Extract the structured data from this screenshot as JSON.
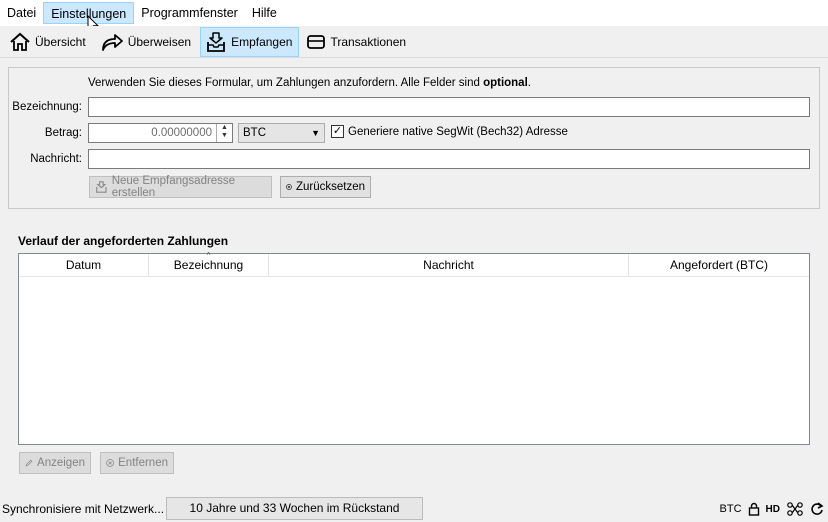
{
  "menubar": {
    "items": [
      {
        "label": "Datei"
      },
      {
        "label": "Einstellungen"
      },
      {
        "label": "Programmfenster"
      },
      {
        "label": "Hilfe"
      }
    ]
  },
  "toolbar": {
    "overview": "Übersicht",
    "send": "Überweisen",
    "receive": "Empfangen",
    "transactions": "Transaktionen"
  },
  "form": {
    "hint_prefix": "Verwenden Sie dieses Formular, um Zahlungen anzufordern. Alle Felder sind ",
    "hint_bold": "optional",
    "hint_suffix": ".",
    "label_label": "Bezeichnung:",
    "label_value": "",
    "amount_label": "Betrag:",
    "amount_value": "0.00000000",
    "unit_value": "BTC",
    "segwit_label": "Generiere native SegWit (Bech32) Adresse",
    "segwit_checked": true,
    "message_label": "Nachricht:",
    "message_value": "",
    "new_address_button": "Neue Empfangsadresse erstellen",
    "reset_button": "Zurücksetzen"
  },
  "history": {
    "title": "Verlauf der angeforderten Zahlungen",
    "columns": [
      "Datum",
      "Bezeichnung",
      "Nachricht",
      "Angefordert (BTC)"
    ],
    "rows": [],
    "show_button": "Anzeigen",
    "remove_button": "Entfernen"
  },
  "status": {
    "sync_text": "Synchronisiere mit Netzwerk...",
    "progress_text": "10 Jahre und 33 Wochen im Rückstand",
    "unit": "BTC",
    "hd": "HD"
  },
  "icons": {
    "overview": "home-icon",
    "send": "send-arrow-icon",
    "receive": "inbox-download-icon",
    "transactions": "card-icon",
    "reset": "x-circle-icon",
    "show": "pencil-icon",
    "remove": "x-circle-icon",
    "lock": "lock-icon",
    "network": "network-icon",
    "sync": "sync-icon"
  },
  "colors": {
    "active_bg": "#cce8ff",
    "active_border": "#99d1ff"
  }
}
